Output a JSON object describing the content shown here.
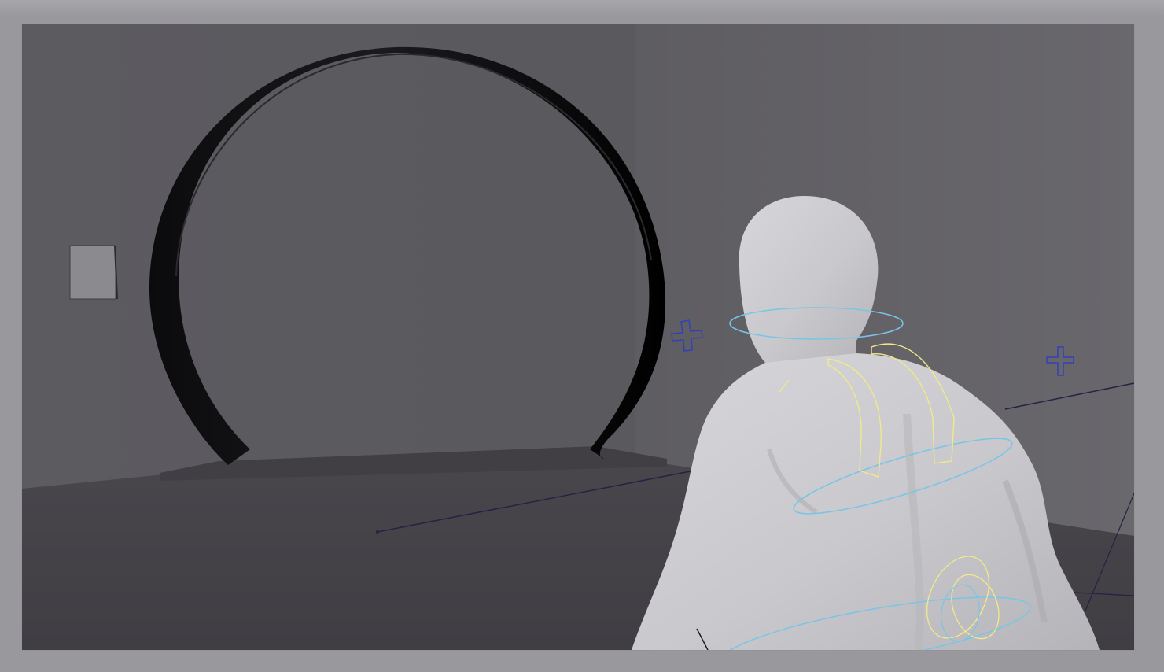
{
  "viewport": {
    "accent_colors": {
      "locator": "#3440b8",
      "joint_ring": "#79c5e6",
      "shoulder_ctrl": "#f0ea8a",
      "guide_line": "#2a1f45"
    },
    "icons": {
      "locator_left": "locator-cross-icon",
      "locator_right": "locator-cross-icon"
    }
  }
}
